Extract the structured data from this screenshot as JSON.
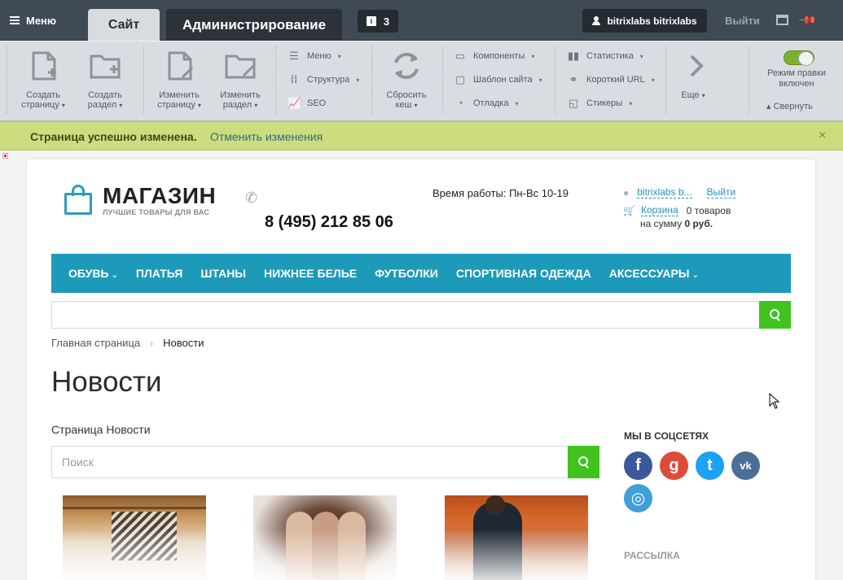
{
  "admin": {
    "menu_label": "Меню",
    "tab_site": "Сайт",
    "tab_admin": "Администрирование",
    "notifications_count": "3",
    "user_name": "bitrixlabs bitrixlabs",
    "logout": "Выйти",
    "toolbar": {
      "create_page": "Создать",
      "create_page2": "страницу",
      "create_section": "Создать",
      "create_section2": "раздел",
      "edit_page": "Изменить",
      "edit_page2": "страницу",
      "edit_section": "Изменить",
      "edit_section2": "раздел",
      "menu": "Меню",
      "structure": "Структура",
      "seo": "SEO",
      "reset_cache": "Сбросить",
      "reset_cache2": "кеш",
      "components": "Компоненты",
      "site_template": "Шаблон сайта",
      "debug": "Отладка",
      "statistics": "Статистика",
      "short_url": "Короткий URL",
      "stickers": "Стикеры",
      "more": "Еще",
      "edit_mode": "Режим правки включен",
      "collapse": "Свернуть"
    }
  },
  "notification": {
    "message": "Страница успешно изменена.",
    "undo": "Отменить изменения",
    "close": "×"
  },
  "site": {
    "logo_title": "МАГАЗИН",
    "logo_subtitle": "ЛУЧШИЕ ТОВАРЫ ДЛЯ ВАС",
    "phone": "8 (495) 212 85 06",
    "hours": "Время работы: Пн-Вс 10-19",
    "account_name": "bitrixlabs b...",
    "account_logout": "Выйти",
    "cart_label": "Корзина",
    "cart_count": "0 товаров",
    "cart_sum_prefix": "на сумму",
    "cart_sum": "0 руб.",
    "nav": [
      {
        "label": "ОБУВЬ",
        "dropdown": true
      },
      {
        "label": "ПЛАТЬЯ",
        "dropdown": false
      },
      {
        "label": "ШТАНЫ",
        "dropdown": false
      },
      {
        "label": "НИЖНЕЕ БЕЛЬЕ",
        "dropdown": false
      },
      {
        "label": "ФУТБОЛКИ",
        "dropdown": false
      },
      {
        "label": "СПОРТИВНАЯ ОДЕЖДА",
        "dropdown": false
      },
      {
        "label": "АКСЕССУАРЫ",
        "dropdown": true
      }
    ],
    "breadcrumb": [
      "Главная страница",
      "Новости"
    ],
    "page_title": "Новости",
    "page_subtitle": "Страница Новости",
    "search_placeholder": "Поиск",
    "social_title": "МЫ В СОЦСЕТЯХ",
    "newsletter_title": "РАССЫЛКА",
    "social": [
      {
        "name": "facebook-icon",
        "glyph": "f",
        "color": "#3b5998"
      },
      {
        "name": "google-plus-icon",
        "glyph": "g",
        "color": "#dd4b39"
      },
      {
        "name": "twitter-icon",
        "glyph": "t",
        "color": "#1da1f2"
      },
      {
        "name": "vk-icon",
        "glyph": "vk",
        "color": "#4a6f95"
      },
      {
        "name": "instagram-icon",
        "glyph": "◎",
        "color": "#3f9fd8"
      }
    ]
  },
  "colors": {
    "admin_bg": "#3f4a55",
    "toolbar_bg": "#d9dde1",
    "notify_bg": "#cddc7f",
    "nav_bg": "#1d9ab9",
    "search_btn": "#3ec31f"
  }
}
